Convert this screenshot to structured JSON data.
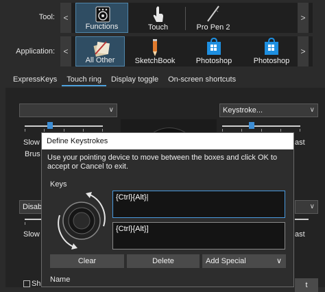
{
  "tool_row": {
    "label": "Tool:",
    "nav_prev": "<",
    "nav_next": ">",
    "items": [
      {
        "label": "Functions",
        "icon": "functions-icon",
        "selected": true
      },
      {
        "label": "Touch",
        "icon": "touch-hand-icon",
        "selected": false
      },
      {
        "label": "Pro Pen 2",
        "icon": "pen-icon",
        "selected": false
      }
    ]
  },
  "application_row": {
    "label": "Application:",
    "nav_prev": "<",
    "nav_next": ">",
    "items": [
      {
        "label": "All Other",
        "icon": "all-other-apps-icon",
        "selected": true
      },
      {
        "label": "SketchBook",
        "icon": "sketchbook-pencil-icon",
        "selected": false
      },
      {
        "label": "Photoshop",
        "icon": "windows-store-icon",
        "selected": false
      },
      {
        "label": "Photoshop",
        "icon": "windows-store-icon",
        "selected": false
      }
    ]
  },
  "tabs": [
    {
      "label": "ExpressKeys",
      "active": false
    },
    {
      "label": "Touch ring",
      "active": true
    },
    {
      "label": "Display toggle",
      "active": false
    },
    {
      "label": "On-screen shortcuts",
      "active": false
    }
  ],
  "panel": {
    "left_dropdown_value": "",
    "right_dropdown_value": "Keystroke...",
    "slow_label": "Slow",
    "fast_partial": "ast",
    "brush_partial": "Brus",
    "disable_partial": "Disab",
    "slow_label_2": "Slow",
    "fast_partial_2": "ast",
    "show_partial": "Sha",
    "t_partial": "t"
  },
  "dialog": {
    "title": "Define Keystrokes",
    "instructions": "Use your pointing device to move between the boxes and click OK to accept or Cancel to exit.",
    "keys_label": "Keys",
    "field1_value": "{Ctrl}{Alt}|",
    "field2_value": "{Ctrl}{Alt}]",
    "clear_button": "Clear",
    "delete_button": "Delete",
    "add_special_button": "Add Special",
    "add_special_chevron": "∨",
    "name_label": "Name"
  },
  "colors": {
    "accent": "#4a9be0",
    "selected_tile": "#2f4d63",
    "background": "#2b2b2b"
  }
}
